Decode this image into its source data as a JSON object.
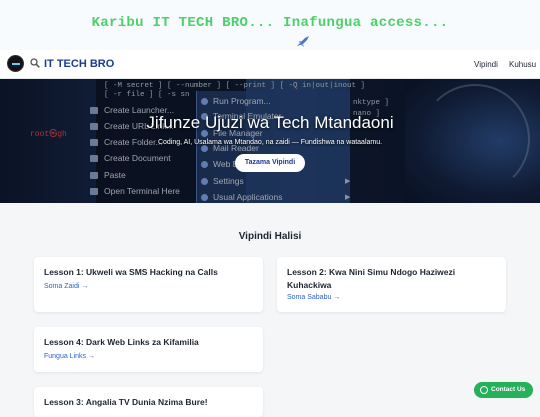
{
  "banner": {
    "text": "Karibu IT TECH BRO... Inafungua access...",
    "icon": "rocket-icon"
  },
  "header": {
    "brand": "IT TECH BRO",
    "brand_icon": "search-icon",
    "nav": [
      {
        "label": "Vipindi"
      },
      {
        "label": "Kuhusu"
      }
    ]
  },
  "hero": {
    "title": "Jifunze Ujuzi wa Tech Mtandaoni",
    "subtitle": "Coding, AI, Usalama wa Mtandao, na zaidi — Fundishwa na wataalamu.",
    "button": "Tazama Vipindi",
    "background": {
      "terminal_lines": [
        "[ -M secret ] [ --number ] [ --print ] [ -Q in|out|inout ]",
        "[ -r file ] [ -s sn"
      ],
      "root_prompt": "root㉿gh",
      "context_menu": [
        "Create Launcher...",
        "Create URL Link...",
        "Create Folder...",
        "Create Document",
        "Paste",
        "Open Terminal Here"
      ],
      "app_menu": [
        "Run Program...",
        "Terminal Emulator",
        "File Manager",
        "Mail Reader",
        "Web Browser",
        "Settings",
        "Usual Applications"
      ],
      "side_code": [
        "nktype ]",
        "nano ]"
      ]
    }
  },
  "lessons_section": {
    "title": "Vipindi Halisi",
    "cards": [
      {
        "title": "Lesson 1: Ukweli wa SMS Hacking na Calls",
        "link": "Soma Zaidi →"
      },
      {
        "title": "Lesson 2: Kwa Nini Simu Ndogo Haziwezi Kuhackiwa",
        "link": "Soma Sababu →"
      },
      {
        "title": "Lesson 4: Dark Web Links za Kifamilia",
        "link": "Fungua Links →"
      },
      {
        "title": "Lesson 3: Angalia TV Dunia Nzima Bure!",
        "link": ""
      }
    ]
  },
  "contact_button": "Contact Us",
  "colors": {
    "banner_text": "#4bd06a",
    "brand": "#1d3b8c",
    "link": "#2d63c8",
    "contact": "#25b05a"
  }
}
